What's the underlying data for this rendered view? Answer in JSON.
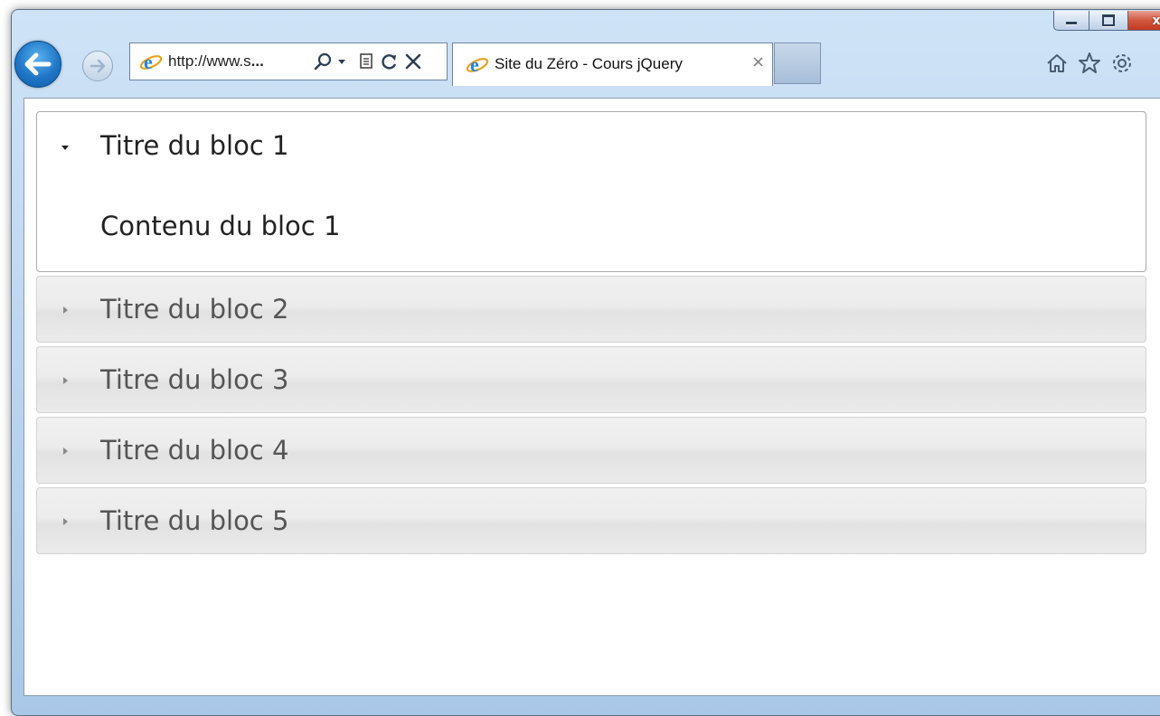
{
  "browser": {
    "address_url_prefix": "http://www.s",
    "address_url_suffix": "...",
    "tab_title": "Site du Zéro - Cours jQuery",
    "tab_close": "×",
    "window_close": "x"
  },
  "accordion": {
    "open_section": {
      "title": "Titre du bloc 1",
      "content": "Contenu du bloc 1"
    },
    "sections": [
      {
        "title": "Titre du bloc 2"
      },
      {
        "title": "Titre du bloc 3"
      },
      {
        "title": "Titre du bloc 4"
      },
      {
        "title": "Titre du bloc 5"
      }
    ]
  },
  "icons": {
    "back": "back-arrow-icon",
    "forward": "forward-arrow-icon",
    "ie_logo": "ie-logo-icon",
    "search": "search-icon",
    "compat": "compatibility-view-icon",
    "refresh": "refresh-icon",
    "stop": "stop-icon",
    "home": "home-icon",
    "favorites": "star-icon",
    "tools": "gear-icon"
  },
  "colors": {
    "frame": "#bed7f0",
    "back_button": "#1f76c7",
    "accordion_header": "#ececec",
    "accordion_border": "#d3d3d3"
  }
}
